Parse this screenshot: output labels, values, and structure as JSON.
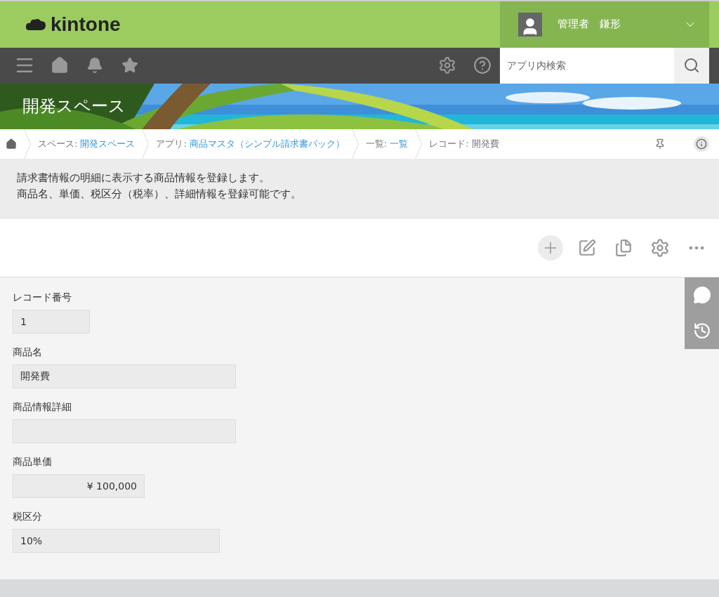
{
  "header": {
    "logo": "kintone",
    "user": "管理者　鎌形"
  },
  "toolbar": {
    "search": {
      "placeholder": "アプリ内検索"
    }
  },
  "banner": {
    "title": "開発スペース"
  },
  "breadcrumb": [
    {
      "label": "スペース:",
      "value": "開発スペース",
      "link": true
    },
    {
      "label": "アプリ:",
      "value": "商品マスタ（シンプル請求書パック）",
      "link": true
    },
    {
      "label": "一覧:",
      "value": "一覧",
      "link": true
    },
    {
      "label": "レコード:",
      "value": "開発費",
      "link": false
    }
  ],
  "description": [
    "請求書情報の明細に表示する商品情報を登録します。",
    "商品名、単価、税区分（税率）、詳細情報を登録可能です。"
  ],
  "fields": [
    {
      "label": "レコード番号",
      "value": "1",
      "kind": "id"
    },
    {
      "label": "商品名",
      "value": "開発費",
      "kind": "text"
    },
    {
      "label": "商品情報詳細",
      "kind": "text"
    },
    {
      "label": "商品単価",
      "value": "¥ 100,000",
      "kind": "number"
    },
    {
      "label": "税区分",
      "value": "10%",
      "kind": "choice"
    }
  ]
}
